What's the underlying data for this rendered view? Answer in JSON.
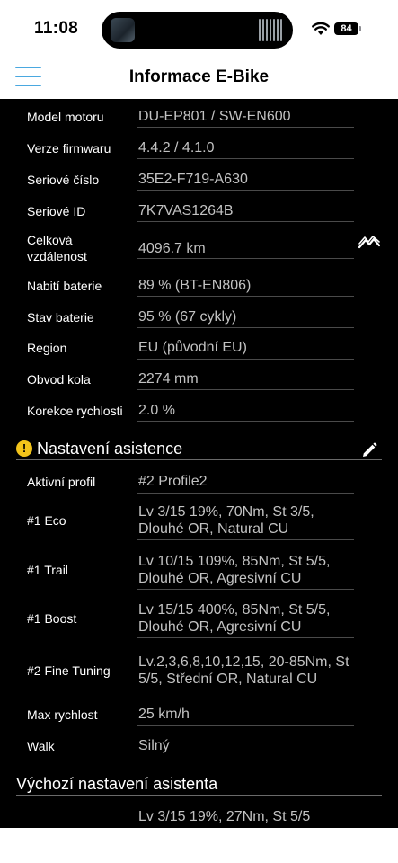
{
  "status": {
    "time": "11:08",
    "battery": "84"
  },
  "nav": {
    "title": "Informace E-Bike"
  },
  "info_rows": [
    {
      "label": "Model motoru",
      "value": "DU-EP801 / SW-EN600"
    },
    {
      "label": "Verze firmwaru",
      "value": "4.4.2 / 4.1.0"
    },
    {
      "label": "Seriové číslo",
      "value": "35E2-F719-A630"
    },
    {
      "label": "Seriové ID",
      "value": "7K7VAS1264B"
    },
    {
      "label": "Celková vzdálenost",
      "label_line1": "Celková",
      "label_line2": "vzdálenost",
      "value": "4096.7 km"
    },
    {
      "label": "Nabití baterie",
      "value": "89 % (BT-EN806)"
    },
    {
      "label": "Stav baterie",
      "value": "95 % (67 cykly)"
    },
    {
      "label": "Region",
      "value": "EU (původní EU)"
    },
    {
      "label": "Obvod kola",
      "value": "2274 mm"
    },
    {
      "label": "Korekce rychlosti",
      "value": "2.0 %"
    }
  ],
  "assist_section": {
    "title": "Nastavení asistence",
    "warning_glyph": "!",
    "rows": [
      {
        "label": "Aktivní profil",
        "value": "#2 Profile2"
      },
      {
        "label": "#1 Eco",
        "line1": "Lv 3/15 19%, 70Nm, St 3/5,",
        "line2": "Dlouhé OR, Natural CU"
      },
      {
        "label": "#1 Trail",
        "line1": "Lv 10/15 109%, 85Nm, St 5/5,",
        "line2": "Dlouhé OR, Agresivní CU"
      },
      {
        "label": "#1 Boost",
        "line1": "Lv 15/15 400%, 85Nm, St 5/5,",
        "line2": "Dlouhé OR, Agresivní CU"
      },
      {
        "label": "#2 Fine Tuning",
        "line1": "Lv.2,3,6,8,10,12,15, 20-85Nm, St",
        "line2": "5/5, Střední OR, Natural CU"
      },
      {
        "label": "Max rychlost",
        "value": "25 km/h"
      },
      {
        "label": "Walk",
        "value": "Silný"
      }
    ]
  },
  "default_section": {
    "title": "Výchozí nastavení asistenta",
    "partial_value": "Lv 3/15 19%, 27Nm, St 5/5"
  },
  "icons": {
    "menu": "hamburger-menu-icon",
    "chart": "trend-chart-icon",
    "edit": "pencil-icon",
    "warning": "warning-icon"
  },
  "colors": {
    "accent": "#4aa8e0",
    "warning": "#f2c31a",
    "background": "#000000",
    "label": "#ffffff",
    "value": "#c2c2c2"
  }
}
